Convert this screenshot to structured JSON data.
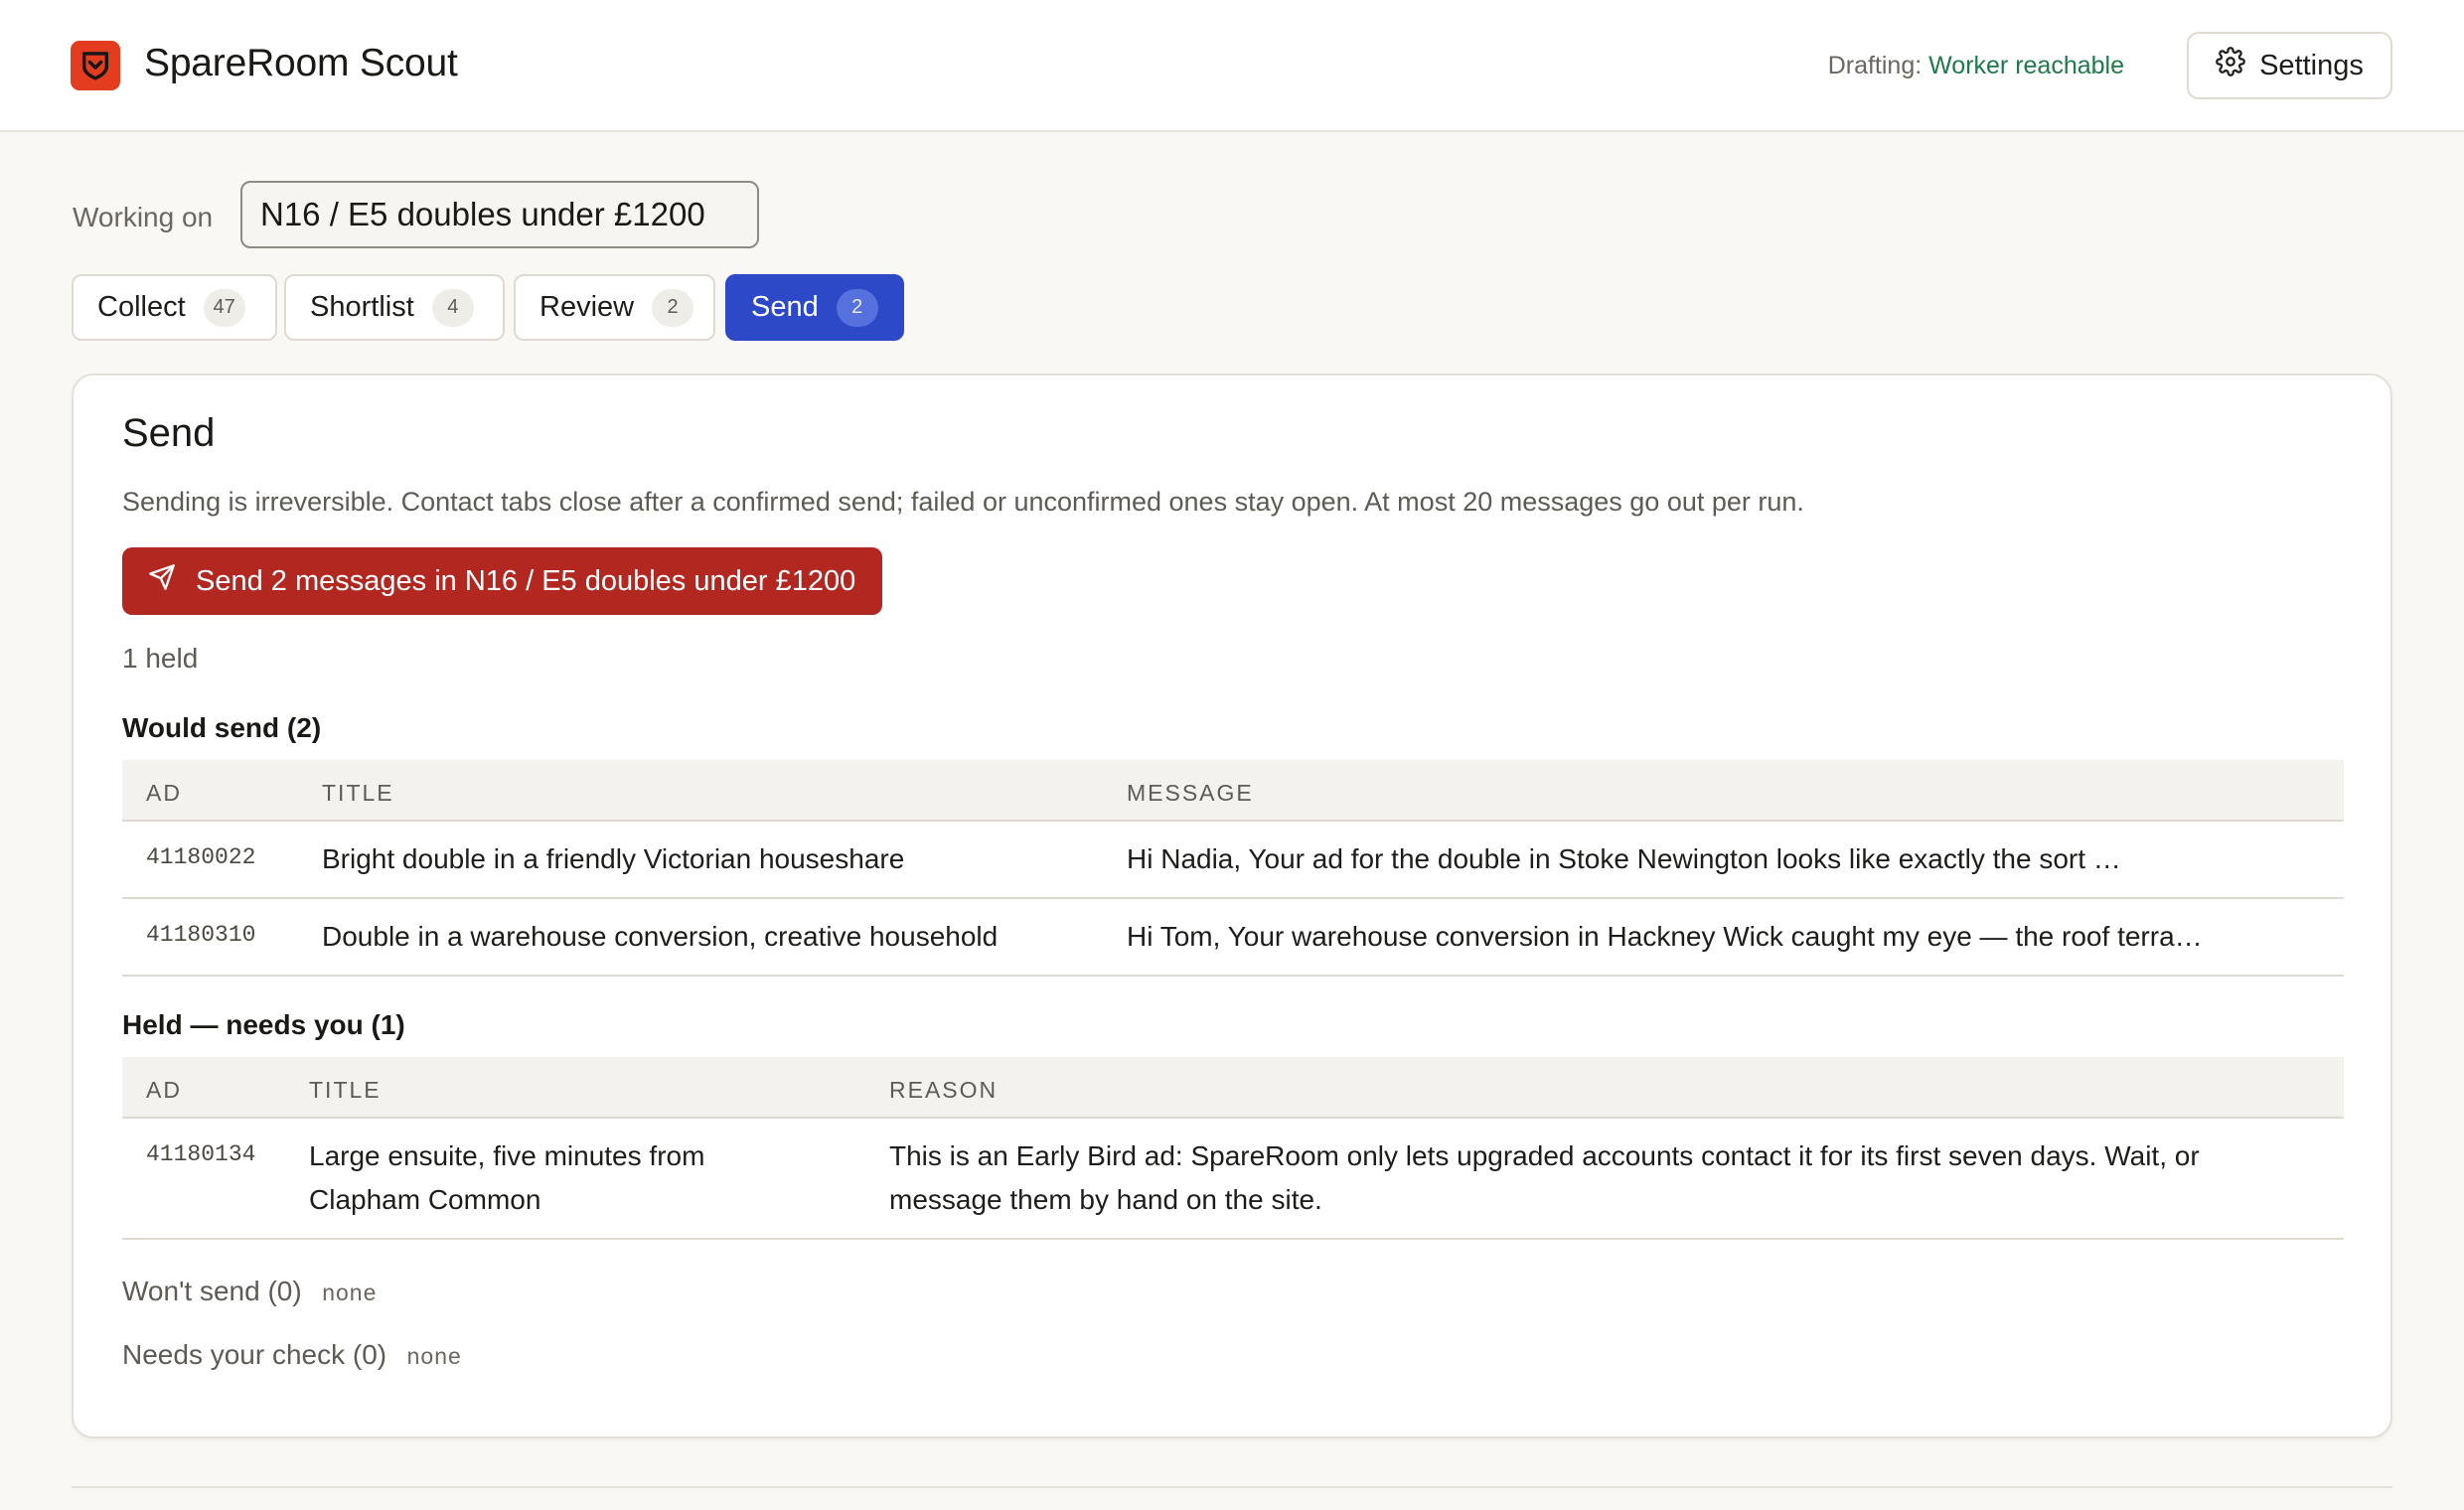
{
  "app": {
    "title": "SpareRoom Scout",
    "logo_icon": "shield-icon",
    "brand_color": "#e43c1f"
  },
  "status": {
    "label": "Drafting:",
    "value": "Worker reachable",
    "value_color": "#1e7a4a"
  },
  "settings": {
    "label": "Settings",
    "icon": "gear-icon"
  },
  "project": {
    "label": "Working on",
    "value": "N16 / E5 doubles under £1200"
  },
  "tabs": [
    {
      "label": "Collect",
      "count": "47",
      "active": false
    },
    {
      "label": "Shortlist",
      "count": "4",
      "active": false
    },
    {
      "label": "Review",
      "count": "2",
      "active": false
    },
    {
      "label": "Send",
      "count": "2",
      "active": true
    }
  ],
  "send": {
    "title": "Send",
    "description": "Sending is irreversible. Contact tabs close after a confirmed send; failed or unconfirmed ones stay open. At most 20 messages go out per run.",
    "button_label": "Send 2 messages in N16 / E5 doubles under £1200",
    "button_icon": "send-icon",
    "button_color": "#b22720",
    "held_summary": "1 held"
  },
  "would_send": {
    "heading": "Would send (2)",
    "columns": [
      "AD",
      "TITLE",
      "MESSAGE"
    ],
    "rows": [
      {
        "ad": "41180022",
        "title": "Bright double in a friendly Victorian houseshare",
        "message": "Hi Nadia, Your ad for the double in Stoke Newington looks like exactly the sort …"
      },
      {
        "ad": "41180310",
        "title": "Double in a warehouse conversion, creative household",
        "message": "Hi Tom, Your warehouse conversion in Hackney Wick caught my eye — the roof terra…"
      }
    ]
  },
  "held": {
    "heading": "Held — needs you (1)",
    "columns": [
      "AD",
      "TITLE",
      "REASON"
    ],
    "rows": [
      {
        "ad": "41180134",
        "title_line1": "Large ensuite, five minutes from",
        "title_line2": "Clapham Common",
        "reason_line1": "This is an Early Bird ad: SpareRoom only lets upgraded accounts contact it for its first seven days. Wait, or",
        "reason_line2": "message them by hand on the site."
      }
    ]
  },
  "wont_send": {
    "label": "Won't send (0)",
    "value": "none"
  },
  "needs_check": {
    "label": "Needs your check (0)",
    "value": "none"
  }
}
